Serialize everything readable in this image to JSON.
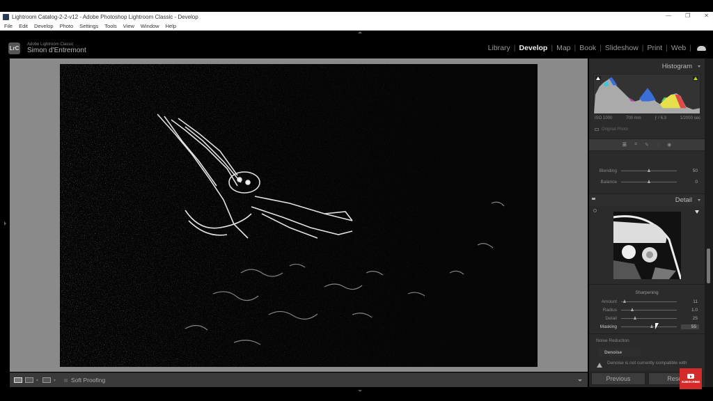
{
  "window": {
    "title": "Lightroom Catalog-2-2-v12 - Adobe Photoshop Lightroom Classic - Develop",
    "controls": [
      "—",
      "❐",
      "✕"
    ]
  },
  "menu": [
    "File",
    "Edit",
    "Develop",
    "Photo",
    "Settings",
    "Tools",
    "View",
    "Window",
    "Help"
  ],
  "identity": {
    "logo": "LrC",
    "product": "Adobe Lightroom Classic",
    "user": "Simon d'Entremont"
  },
  "modules": [
    {
      "label": "Library",
      "active": false
    },
    {
      "label": "Develop",
      "active": true
    },
    {
      "label": "Map",
      "active": false
    },
    {
      "label": "Book",
      "active": false
    },
    {
      "label": "Slideshow",
      "active": false
    },
    {
      "label": "Print",
      "active": false
    },
    {
      "label": "Web",
      "active": false
    }
  ],
  "histogram": {
    "title": "Histogram",
    "iso": "ISO 1000",
    "focal": "700 mm",
    "aperture": "ƒ / 6.3",
    "shutter": "1/2000 sec",
    "original_photo": "Original Photo",
    "clip_shadow_color": "#ffffff",
    "clip_highlight_color": "#b8d400"
  },
  "tool_strip": [
    "edit-sliders",
    "crop",
    "heal",
    "mask",
    "red-eye"
  ],
  "color_grading": {
    "blending": {
      "label": "Blending",
      "value": "50",
      "fraction": 0.5
    },
    "balance": {
      "label": "Balance",
      "value": "0",
      "fraction": 0.5
    }
  },
  "detail": {
    "title": "Detail",
    "sharpening_title": "Sharpening",
    "sliders": [
      {
        "label": "Amount",
        "value": "11",
        "fraction": 0.07,
        "highlight": false
      },
      {
        "label": "Radius",
        "value": "1.0",
        "fraction": 0.2,
        "highlight": false
      },
      {
        "label": "Detail",
        "value": "25",
        "fraction": 0.25,
        "highlight": false
      },
      {
        "label": "Masking",
        "value": "55",
        "fraction": 0.55,
        "highlight": true
      }
    ],
    "noise_reduction_title": "Noise Reduction",
    "denoise_label": "Denoise",
    "warning": "Denoise is not currently compatible with"
  },
  "toolbar": {
    "soft_proofing": "Soft Proofing"
  },
  "buttons": {
    "previous": "Previous",
    "reset": "Reset"
  },
  "overlay": {
    "subscribe": "SUBSCRIBE"
  }
}
